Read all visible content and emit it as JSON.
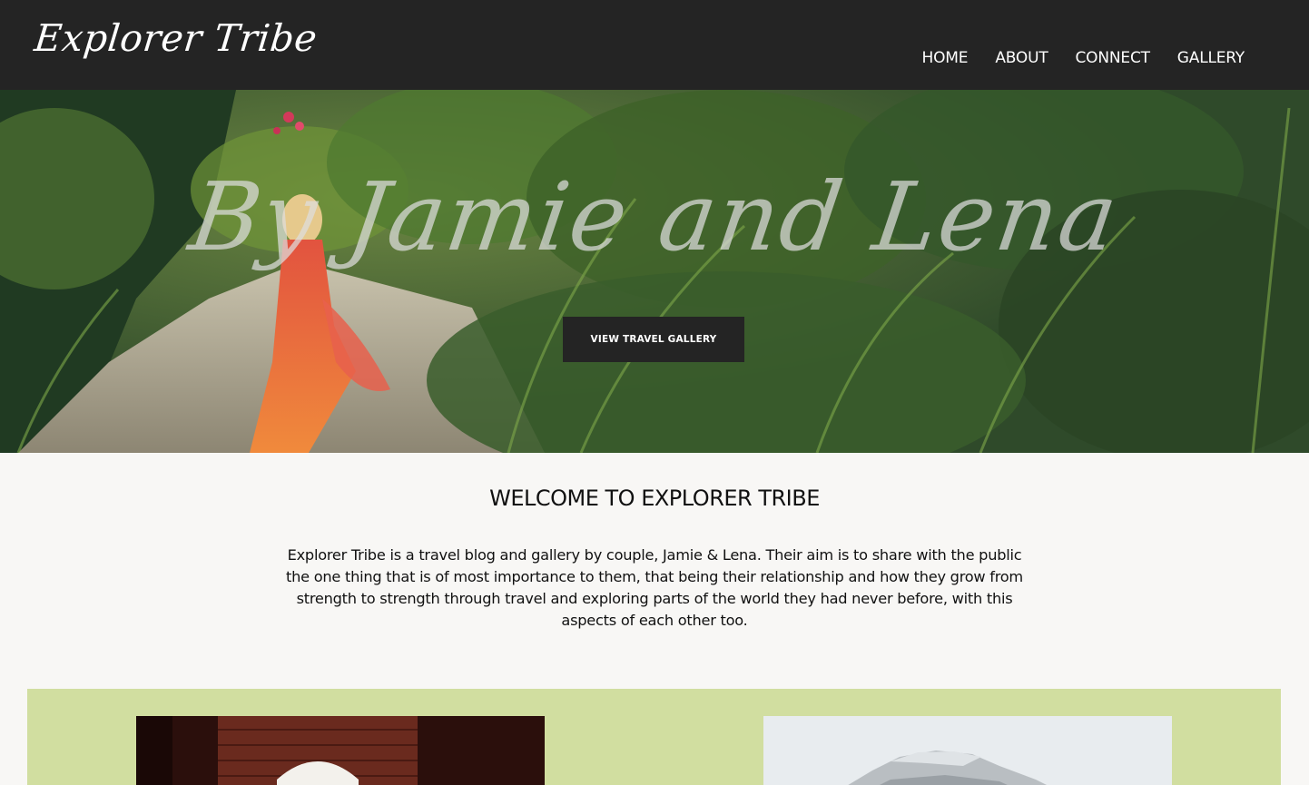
{
  "header": {
    "logo_text": "Explorer Tribe",
    "nav": [
      {
        "label": "HOME"
      },
      {
        "label": "ABOUT"
      },
      {
        "label": "CONNECT"
      },
      {
        "label": "GALLERY"
      }
    ]
  },
  "hero": {
    "title": "By Jamie and Lena",
    "button_label": "VIEW TRAVEL GALLERY"
  },
  "welcome": {
    "heading": "WELCOME TO EXPLORER TRIBE",
    "body": "Explorer Tribe is a travel blog and gallery by couple, Jamie & Lena. Their aim is to share with the public the one thing that is of most importance to them, that being their relationship and how they grow from strength to strength through travel and exploring parts of the world they had never before, with this aspects of each other too."
  },
  "colors": {
    "header_bg": "#242424",
    "page_bg": "#f8f7f5",
    "gallery_band_bg": "#d1dea0",
    "button_bg": "#242424"
  }
}
